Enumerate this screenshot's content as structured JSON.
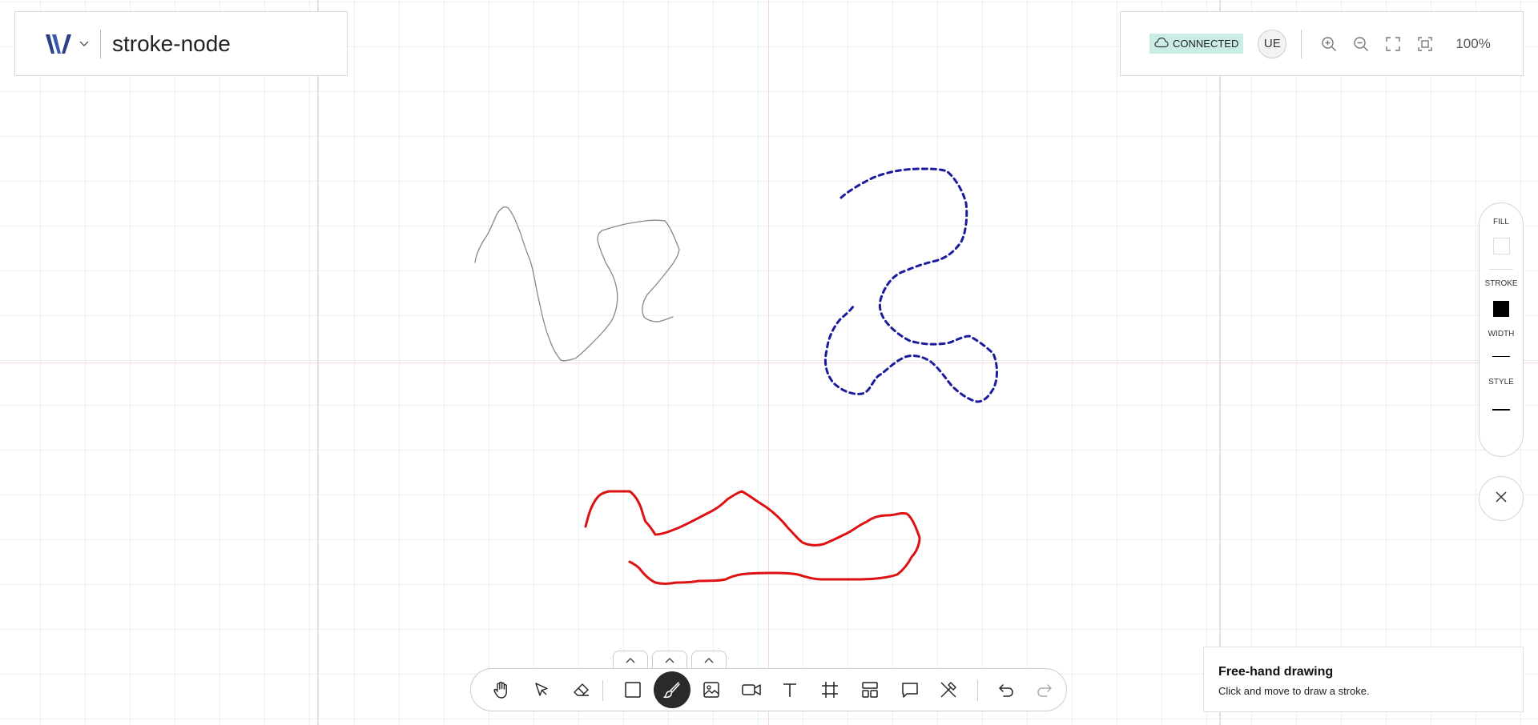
{
  "header": {
    "logo_icon": "wavelet-logo-icon",
    "menu_chevron": "⌄",
    "document_title": "stroke-node"
  },
  "status": {
    "connection_label": "CONNECTED",
    "connection_color": "#c9ede4",
    "cloud_icon": "cloud-icon",
    "user_initials": "UE",
    "zoom_label": "100%",
    "controls": [
      "zoom-in-icon",
      "zoom-out-icon",
      "fullscreen-icon",
      "fit-to-screen-icon"
    ]
  },
  "properties": {
    "fill_label": "FILL",
    "stroke_label": "STROKE",
    "width_label": "WIDTH",
    "style_label": "STYLE",
    "fill_color": "#ffffff",
    "stroke_color": "#000000"
  },
  "toolbar": {
    "active_tool": "draw",
    "tools": [
      "hand-icon",
      "select-arrow-icon",
      "eraser-icon",
      "rectangle-icon",
      "brush-icon",
      "image-icon",
      "video-icon",
      "text-icon",
      "frame-icon",
      "layout-icon",
      "comment-icon",
      "laser-pointer-icon",
      "undo-icon",
      "redo-icon"
    ]
  },
  "hint": {
    "title": "Free-hand drawing",
    "text": "Click and move to draw a stroke."
  },
  "strokes": [
    {
      "name": "gray-stroke",
      "color": "#888888",
      "style": "solid"
    },
    {
      "name": "blue-dashed-stroke",
      "color": "#1b1b9e",
      "style": "dashed"
    },
    {
      "name": "red-stroke",
      "color": "#dd1111",
      "style": "solid"
    }
  ]
}
